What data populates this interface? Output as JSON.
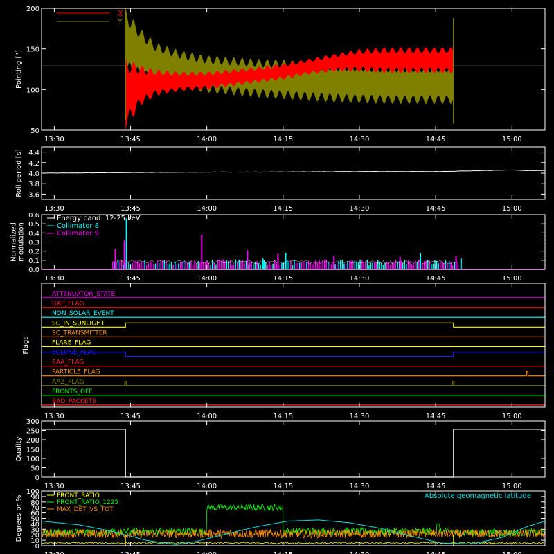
{
  "colors": {
    "x_series": "#ff0000",
    "y_series": "#808000",
    "axis": "#ffffff",
    "ref_line": "#9a9a9a",
    "trace": "#ffffff",
    "energy_band": "#ffffff",
    "collimator_8": "#00ffff",
    "collimator_9": "#ff00ff",
    "front_ratio": "#ffff00",
    "front_ratio_1225": "#00ff00",
    "max_det_vs_tot": "#ff8c00",
    "geomag": "#00e0e0"
  },
  "time_axis": {
    "ticks": [
      "13:30",
      "13:45",
      "14:00",
      "14:15",
      "14:30",
      "14:45",
      "15:00"
    ],
    "tick_minutes": [
      0,
      15,
      30,
      45,
      60,
      75,
      90
    ],
    "range_minutes": [
      -2.5,
      96.5
    ]
  },
  "chart_data": [
    {
      "id": "pointing",
      "type": "area",
      "ylabel": "Pointing [\"]",
      "ylim": [
        50,
        200
      ],
      "yticks": [
        50,
        100,
        150,
        200
      ],
      "legend": [
        {
          "label": "X",
          "color": "#ff0000"
        },
        {
          "label": "Y",
          "color": "#808000"
        }
      ],
      "reference_level": 129,
      "active_minutes": [
        14,
        78.5
      ],
      "series": [
        {
          "name": "X",
          "x": [
            14,
            17,
            20,
            25,
            30,
            35,
            40,
            45,
            50,
            55,
            60,
            65,
            70,
            75,
            78.5
          ],
          "low": [
            50,
            80,
            92,
            98,
            100,
            104,
            108,
            112,
            118,
            122,
            122,
            120,
            120,
            120,
            120
          ],
          "high": [
            140,
            130,
            125,
            122,
            122,
            125,
            128,
            132,
            138,
            144,
            150,
            152,
            152,
            152,
            152
          ]
        },
        {
          "name": "Y",
          "x": [
            14,
            17,
            20,
            25,
            30,
            35,
            40,
            45,
            50,
            55,
            60,
            65,
            70,
            75,
            78.5
          ],
          "low": [
            118,
            113,
            106,
            100,
            96,
            93,
            90,
            88,
            86,
            84,
            83,
            82,
            82,
            82,
            82
          ],
          "high": [
            200,
            175,
            158,
            148,
            142,
            140,
            138,
            137,
            135,
            134,
            133,
            132,
            132,
            132,
            132
          ]
        }
      ]
    },
    {
      "id": "roll",
      "type": "line",
      "ylabel": "Roll period [s]",
      "ylim": [
        3.5,
        4.5
      ],
      "yticks": [
        3.6,
        3.8,
        4.0,
        4.2,
        4.4
      ],
      "series": [
        {
          "name": "",
          "x": [
            -2.5,
            30,
            40,
            60,
            75,
            80,
            85,
            90,
            92,
            96.5
          ],
          "y": [
            4.0,
            4.02,
            4.02,
            4.03,
            4.03,
            4.04,
            4.05,
            4.06,
            4.05,
            4.05
          ]
        }
      ]
    },
    {
      "id": "modulation",
      "type": "bar",
      "ylabel": [
        "Normalized",
        "modulation"
      ],
      "ylim": [
        0,
        0.6
      ],
      "yticks": [
        0.0,
        0.1,
        0.2,
        0.3,
        0.4,
        0.5,
        0.6
      ],
      "active_minutes": [
        11.5,
        79.5
      ],
      "legend": [
        {
          "label": "Energy band: 12-25 keV",
          "color": "#ffffff"
        },
        {
          "label": "Collimator 8",
          "color": "#00ffff"
        },
        {
          "label": "Collimator 9",
          "color": "#ff00ff"
        }
      ],
      "series": [
        {
          "name": "Collimator 8",
          "baseline": 0.08,
          "peaks": [
            [
              14.2,
              0.56
            ],
            [
              41,
              0.12
            ],
            [
              45.5,
              0.18
            ],
            [
              72,
              0.18
            ],
            [
              80,
              0.12
            ]
          ]
        },
        {
          "name": "Collimator 9",
          "baseline": 0.08,
          "peaks": [
            [
              12,
              0.22
            ],
            [
              13.8,
              0.32
            ],
            [
              29,
              0.38
            ],
            [
              38,
              0.21
            ],
            [
              44,
              0.17
            ],
            [
              55,
              0.15
            ],
            [
              68,
              0.14
            ],
            [
              79,
              0.15
            ]
          ]
        }
      ]
    },
    {
      "id": "flags",
      "type": "line",
      "ylabel": "Flags",
      "rows": [
        {
          "label": "ATTENUATOR_STATE",
          "color": "#ff00ff",
          "steps": []
        },
        {
          "label": "GAP_FLAG",
          "color": "#ff2020",
          "steps": []
        },
        {
          "label": "NON_SOLAR_EVENT",
          "color": "#00ffff",
          "steps": []
        },
        {
          "label": "SC_IN_SUNLIGHT",
          "color": "#ffff00",
          "steps": [
            [
              14,
              78.5
            ]
          ]
        },
        {
          "label": "SC_TRANSMITTER",
          "color": "#ff8c00",
          "steps": []
        },
        {
          "label": "FLARE_FLAG",
          "color": "#ffff00",
          "steps": []
        },
        {
          "label": "ECLIPSE_FLAG",
          "color": "#2020ff",
          "inverted": true,
          "steps": [
            [
              14,
              78.5
            ]
          ]
        },
        {
          "label": "SAA_FLAG",
          "color": "#ff2020",
          "steps": []
        },
        {
          "label": "PARTICLE_FLAG",
          "color": "#ff8c00",
          "spikes": [
            93
          ]
        },
        {
          "label": "AAZ_FLAG",
          "color": "#808000",
          "spikes": [
            14,
            78.5
          ]
        },
        {
          "label": "FRONTS_OFF",
          "color": "#00ff00",
          "steps": []
        },
        {
          "label": "BAD_PACKETS",
          "color": "#ff2020",
          "steps": []
        }
      ]
    },
    {
      "id": "quality",
      "type": "line",
      "ylabel": "Quality",
      "ylim": [
        0,
        300
      ],
      "yticks": [
        0,
        50,
        100,
        150,
        200,
        250,
        300
      ],
      "series": [
        {
          "name": "",
          "x": [
            -2.5,
            14,
            14,
            78.5,
            78.5,
            96.5
          ],
          "y": [
            256,
            256,
            0,
            0,
            256,
            256
          ]
        }
      ]
    },
    {
      "id": "ratios",
      "type": "line",
      "ylabel": "Degrees or %",
      "ylim": [
        0,
        100
      ],
      "yticks": [
        0,
        10,
        20,
        30,
        40,
        50,
        60,
        70,
        80,
        90,
        100
      ],
      "legend": [
        {
          "label": "FRONT_RATIO",
          "color": "#ffff00"
        },
        {
          "label": "FRONT_RATIO_1225",
          "color": "#00ff00"
        },
        {
          "label": "MAX_DET_VS_TOT",
          "color": "#ff8c00"
        }
      ],
      "right_label": "Absolute geomagnetic latitude",
      "series": [
        {
          "name": "Absolute geomagnetic latitude",
          "x": [
            -2.5,
            5,
            12,
            18,
            24,
            28,
            34,
            40,
            46,
            52,
            58,
            64,
            70,
            76,
            82,
            88,
            93,
            96.5
          ],
          "y": [
            45,
            38,
            25,
            10,
            2,
            8,
            22,
            35,
            45,
            47,
            42,
            32,
            18,
            5,
            3,
            15,
            35,
            45
          ]
        },
        {
          "name": "FRONT_RATIO_1225",
          "segments": [
            [
              [
                30,
                70
              ],
              [
                45,
                70
              ]
            ],
            [
              [
                75,
                40
              ],
              [
                76.5,
                40
              ]
            ]
          ]
        },
        {
          "name": "MAX_DET_VS_TOT",
          "level": 22,
          "spread": 8
        },
        {
          "name": "FRONT_RATIO",
          "level": 5
        }
      ]
    }
  ]
}
